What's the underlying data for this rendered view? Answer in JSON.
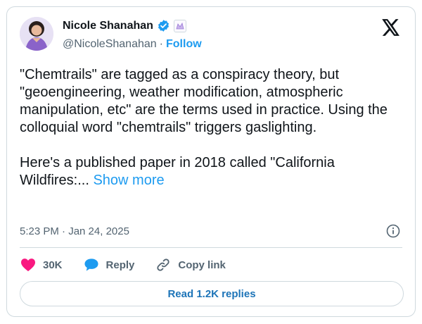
{
  "author": {
    "display_name": "Nicole Shanahan",
    "handle": "@NicoleShanahan",
    "separator": "·",
    "follow_label": "Follow"
  },
  "tweet": {
    "text": "\"Chemtrails\" are tagged as a conspiracy theory, but \"geoengineering, weather modification, atmospheric manipulation, etc\" are the terms used in practice. Using the colloquial word \"chemtrails\" triggers gaslighting.\n\nHere's a published paper in 2018 called \"California Wildfires:... ",
    "show_more_label": "Show more",
    "timestamp": "5:23 PM · Jan 24, 2025"
  },
  "actions": {
    "like_count": "30K",
    "reply_label": "Reply",
    "copy_link_label": "Copy link"
  },
  "read_replies_label": "Read 1.2K replies",
  "colors": {
    "accent": "#1d9bf0",
    "heart": "#f91880",
    "verified": "#1d9bf0",
    "muted_text": "#536471",
    "border": "#cfd9de"
  },
  "icons": [
    "verified-badge-icon",
    "affiliate-badge-icon",
    "x-logo-icon",
    "info-icon",
    "heart-icon",
    "reply-bubble-icon",
    "link-icon"
  ]
}
